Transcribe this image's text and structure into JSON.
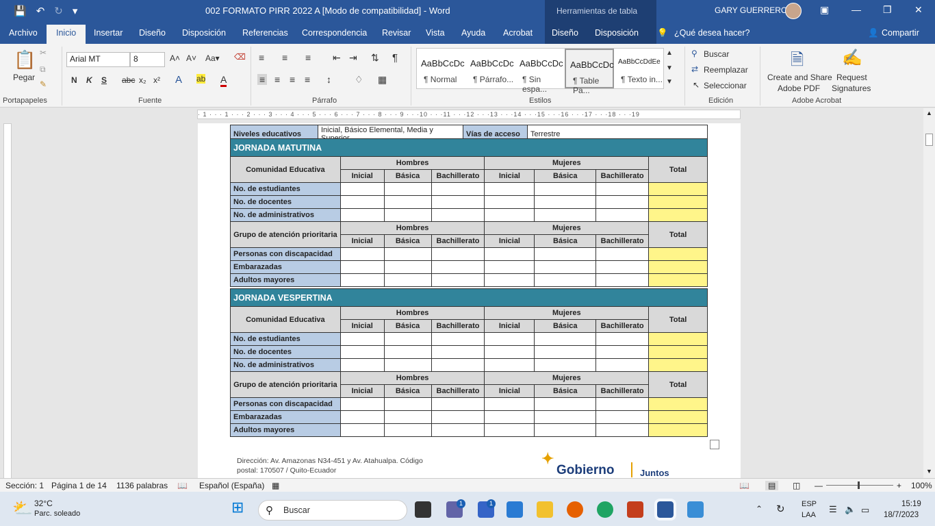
{
  "window": {
    "title": "002 FORMATO PIRR 2022 A [Modo de compatibilidad]  -  Word",
    "context_tab": "Herramientas de tabla",
    "user": "GARY GUERRERO"
  },
  "tabs": [
    "Archivo",
    "Inicio",
    "Insertar",
    "Diseño",
    "Disposición",
    "Referencias",
    "Correspondencia",
    "Revisar",
    "Vista",
    "Ayuda",
    "Acrobat",
    "Diseño",
    "Disposición"
  ],
  "tell_me": "¿Qué desea hacer?",
  "share": "Compartir",
  "ribbon": {
    "paste": "Pegar",
    "font_name": "Arial MT",
    "font_size": "8",
    "groups": [
      "Portapapeles",
      "Fuente",
      "Párrafo",
      "Estilos",
      "Edición",
      "Adobe Acrobat"
    ],
    "styles": [
      {
        "sample": "AaBbCcDc",
        "name": "¶ Normal"
      },
      {
        "sample": "AaBbCcDc",
        "name": "¶ Párrafo..."
      },
      {
        "sample": "AaBbCcDc",
        "name": "¶ Sin espa..."
      },
      {
        "sample": "AaBbCcDc",
        "name": "¶ Table Pa..."
      },
      {
        "sample": "AaBbCcDdEe",
        "name": "¶ Texto in..."
      }
    ],
    "find": "Buscar",
    "replace": "Reemplazar",
    "select": "Seleccionar",
    "create_pdf_1": "Create and Share",
    "create_pdf_2": "Adobe PDF",
    "request_1": "Request",
    "request_2": "Signatures"
  },
  "doc": {
    "top_row": {
      "l1": "Niveles educativos",
      "v1": "Inicial, Básico Elemental, Media y Superior",
      "l2": "Vías de acceso",
      "v2": "Terrestre"
    },
    "sections": [
      {
        "title": "JORNADA MATUTINA",
        "comunidad": "Comunidad Educativa",
        "grupo": "Grupo de atención prioritaria",
        "hombres": "Hombres",
        "mujeres": "Mujeres",
        "total": "Total",
        "sub": [
          "Inicial",
          "Básica",
          "Bachillerato",
          "Inicial",
          "Básica",
          "Bachillerato"
        ],
        "rows_a": [
          "No. de estudiantes",
          "No. de docentes",
          "No. de administrativos"
        ],
        "rows_b": [
          "Personas con discapacidad",
          "Embarazadas",
          "Adultos mayores"
        ]
      },
      {
        "title": "JORNADA VESPERTINA",
        "comunidad": "Comunidad Educativa",
        "grupo": "Grupo de atención prioritaria",
        "hombres": "Hombres",
        "mujeres": "Mujeres",
        "total": "Total",
        "sub": [
          "Inicial",
          "Básica",
          "Bachillerato",
          "Inicial",
          "Básica",
          "Bachillerato"
        ],
        "rows_a": [
          "No. de estudiantes",
          "No. de docentes",
          "No. de administrativos"
        ],
        "rows_b": [
          "Personas con discapacidad",
          "Embarazadas",
          "Adultos mayores"
        ]
      }
    ],
    "footer_1": "Dirección: Av. Amazonas N34-451 y Av. Atahualpa. Código",
    "footer_2": "postal: 170507 / Quito-Ecuador",
    "logo": "Gobierno",
    "logo2": "Juntos"
  },
  "status": {
    "section": "Sección: 1",
    "page": "Página 1 de 14",
    "words": "1136 palabras",
    "lang": "Español (España)",
    "zoom": "100%"
  },
  "taskbar": {
    "temp": "32°C",
    "weather": "Parc. soleado",
    "search": "Buscar",
    "lang1": "ESP",
    "lang2": "LAA",
    "time": "15:19",
    "date": "18/7/2023",
    "badge1": "1",
    "badge2": "1"
  },
  "colors": {
    "accent": "#2b579a",
    "header_teal": "#31849b",
    "row_blue": "#b8cce4",
    "total_yellow": "#fff58a"
  }
}
